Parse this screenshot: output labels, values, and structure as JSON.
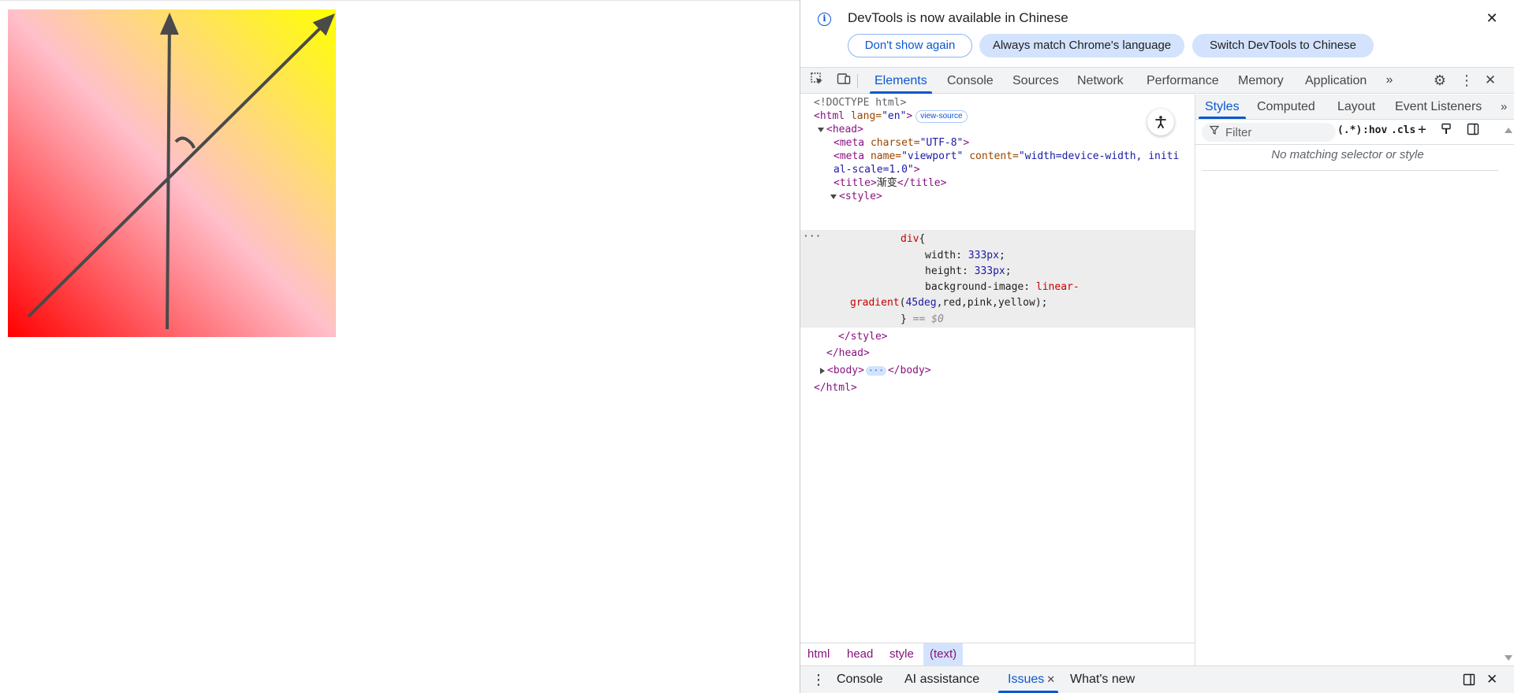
{
  "page": {
    "gradient": {
      "angle": "45deg",
      "stops": [
        "red",
        "pink",
        "yellow"
      ]
    },
    "annotation_colors": {
      "stroke": "#4a4a4a"
    }
  },
  "infobar": {
    "message": "DevTools is now available in Chinese",
    "buttons": [
      "Don't show again",
      "Always match Chrome's language",
      "Switch DevTools to Chinese"
    ]
  },
  "main_tabs": [
    "Elements",
    "Console",
    "Sources",
    "Network",
    "Performance",
    "Memory",
    "Application"
  ],
  "main_tabs_active": "Elements",
  "dom": {
    "doctype": "<!DOCTYPE html>",
    "html_open": "<html",
    "lang_attr": " lang=",
    "lang_val": "\"en\"",
    "gt": ">",
    "view_source": "view-source",
    "head": "<head>",
    "meta1_open": "<meta",
    "meta1_attr": " charset=",
    "meta1_val": "\"UTF-8\"",
    "meta2_open": "<meta",
    "meta2_attr1": " name=",
    "meta2_val1": "\"viewport\"",
    "meta2_attr2": " content=",
    "meta2_val2a": "\"width=device-width, initi",
    "meta2_val2b": "al-scale=1.0\"",
    "title_open": "<title>",
    "title_text": "渐变",
    "title_close": "</title>",
    "style_open": "<style>",
    "css_selector": "div",
    "css_brace_open": "{",
    "css_width_prop": "width: ",
    "css_width_val": "333px",
    "css_height_prop": "height: ",
    "css_height_val": "333px",
    "css_bg_prop": "background-image: ",
    "css_bg_fn_a": "linear-",
    "css_bg_fn_b": "gradient",
    "css_bg_args_open": "(",
    "css_bg_deg": "45deg",
    "css_bg_rest": ",red,pink,yellow",
    "css_bg_close": ");",
    "css_brace_close": "}",
    "eq_dollar0": "== $0",
    "style_close": "</style>",
    "head_close": "</head>",
    "body_open": "<body>",
    "body_dots": "···",
    "body_close": "</body>",
    "html_close": "</html>",
    "semicolon": ";",
    "gutter_dots": "···"
  },
  "breadcrumbs": [
    "html",
    "head",
    "style",
    "(text)"
  ],
  "styles_tabs": [
    "Styles",
    "Computed",
    "Layout",
    "Event Listeners"
  ],
  "styles_filter": {
    "placeholder": "Filter",
    "regex": "(.*)",
    "hov": ":hov",
    "cls": ".cls"
  },
  "no_match": "No matching selector or style",
  "drawer_tabs": [
    "Console",
    "AI assistance",
    "Issues",
    "What's new"
  ],
  "drawer_active": "Issues"
}
